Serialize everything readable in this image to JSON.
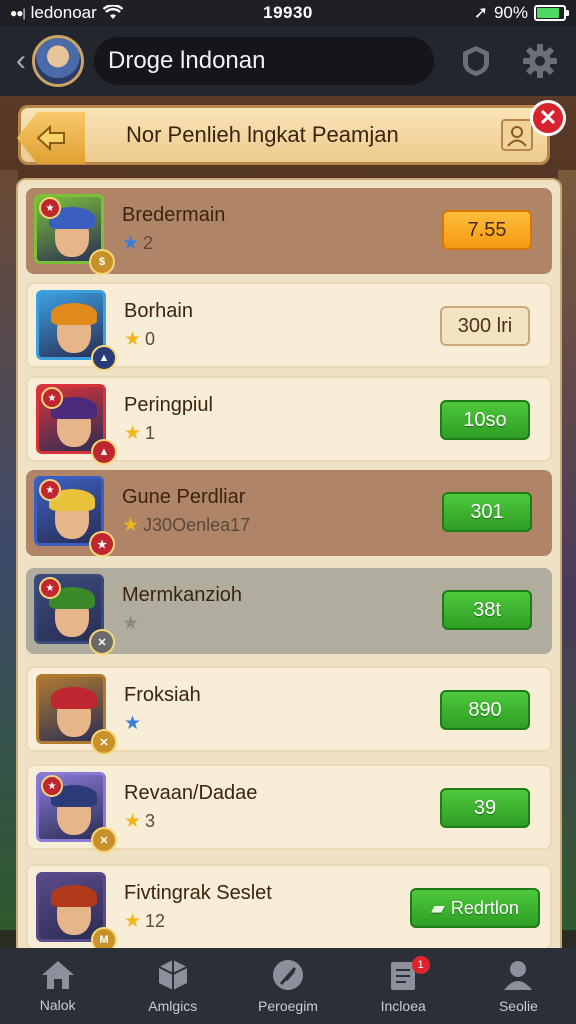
{
  "status_bar": {
    "carrier": "ledonoar",
    "time": "19930",
    "battery": "90%"
  },
  "app_bar": {
    "search_text": "Droge lndonan"
  },
  "banner": {
    "title": "Nor Penlieh lngkat Peamjan"
  },
  "rows": [
    {
      "name": "Bredermain",
      "sub": "2",
      "star": "blue",
      "value": "7.55",
      "style": "orange",
      "bg": "brown",
      "frame": "#7cc03a",
      "hat": "#3b5fc0",
      "badge_tl": true,
      "badge_br": "#c9912a",
      "br_text": "$"
    },
    {
      "name": "Borhain",
      "sub": "0",
      "star": "gold",
      "value": "300 lri",
      "style": "tan",
      "bg": "light",
      "frame": "#3b9fe0",
      "hat": "#e08a1a",
      "badge_tl": false,
      "badge_br": "#2a3b78",
      "br_text": "▲"
    },
    {
      "name": "Peringpiul",
      "sub": "1",
      "star": "gold",
      "value": "10so",
      "style": "green",
      "bg": "light",
      "frame": "#d8333c",
      "hat": "#4a2a7a",
      "badge_tl": true,
      "badge_br": "#c0262f",
      "br_text": "▲"
    },
    {
      "name": "Gune Perdliar",
      "sub": "J30Oenlea17",
      "star": "gold",
      "value": "301",
      "style": "green",
      "bg": "brown",
      "frame": "#3b5fc0",
      "hat": "#e8c23a",
      "badge_tl": true,
      "badge_br": "#c0262f",
      "br_text": "★"
    },
    {
      "name": "Mermkanzioh",
      "sub": "",
      "star": "gray",
      "value": "38t",
      "style": "green",
      "bg": "gray",
      "frame": "#3a4a7a",
      "hat": "#3a8a2a",
      "badge_tl": true,
      "badge_br": "#6a6a6a",
      "br_text": "✕"
    },
    {
      "name": "Froksiah",
      "sub": "",
      "star": "blue",
      "value": "890",
      "style": "green",
      "bg": "light",
      "frame": "#b07a30",
      "hat": "#c0262f",
      "badge_tl": false,
      "badge_br": "#c9912a",
      "br_text": "✕"
    },
    {
      "name": "Revaan/Dadae",
      "sub": "3",
      "star": "gold",
      "value": "39",
      "style": "green",
      "bg": "light",
      "frame": "#8a7ad8",
      "hat": "#2a3b78",
      "badge_tl": true,
      "badge_br": "#c9912a",
      "br_text": "✕"
    },
    {
      "name": "Fivtingrak Seslet",
      "sub": "12",
      "star": "gold",
      "value": "Redrtlon",
      "style": "green",
      "bg": "light",
      "frame": "#5a4a8a",
      "hat": "#b03a1a",
      "badge_tl": false,
      "badge_br": "#c9912a",
      "br_text": "M"
    }
  ],
  "bottom_nav": [
    {
      "label": "Nalok",
      "icon": "home-icon"
    },
    {
      "label": "Amlgics",
      "icon": "cube-icon"
    },
    {
      "label": "Peroegim",
      "icon": "feather-icon"
    },
    {
      "label": "Incloea",
      "icon": "document-icon",
      "badge": "1"
    },
    {
      "label": "Seolie",
      "icon": "user-icon"
    }
  ],
  "colors": {
    "accent_green": "#2e9e24",
    "accent_orange": "#f59a12",
    "close_red": "#d8232e"
  }
}
